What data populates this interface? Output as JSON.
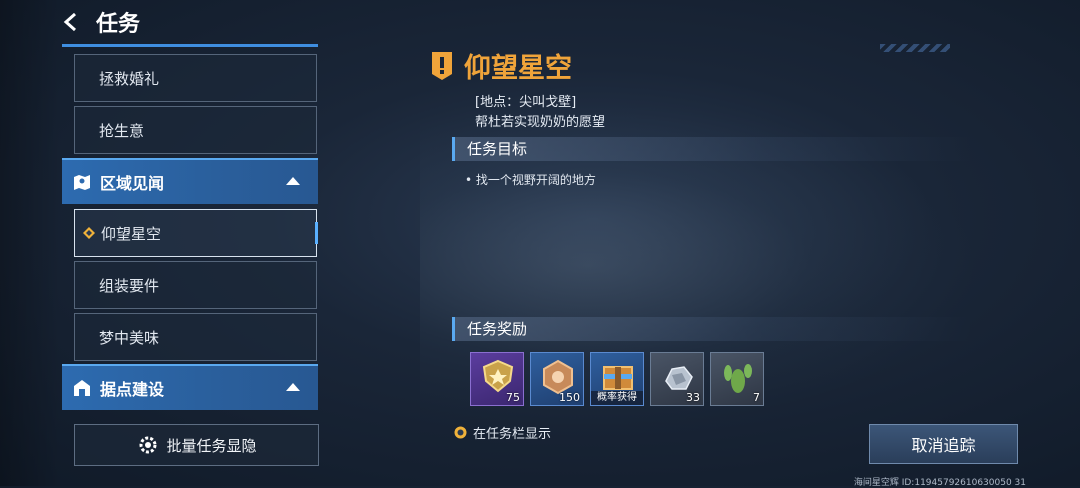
{
  "header": {
    "title": "任务"
  },
  "sidebar": {
    "items_top": [
      {
        "label": "拯救婚礼"
      },
      {
        "label": "抢生意"
      }
    ],
    "category_1": {
      "label": "区域见闻",
      "icon": "map-icon"
    },
    "items_mid": [
      {
        "label": "仰望星空",
        "selected": true
      },
      {
        "label": "组装要件"
      },
      {
        "label": "梦中美味"
      }
    ],
    "category_2": {
      "label": "据点建设",
      "icon": "base-icon"
    },
    "bulk_button": {
      "label": "批量任务显隐",
      "icon": "gear-icon"
    }
  },
  "quest": {
    "title": "仰望星空",
    "location": "[地点：尖叫戈壁]",
    "description": "帮杜若实现奶奶的愿望",
    "objective_header": "任务目标",
    "objective": "• 找一个视野开阔的地方",
    "reward_header": "任务奖励",
    "rewards": [
      {
        "icon": "rank-badge-icon",
        "count": "75",
        "rarity": "purple"
      },
      {
        "icon": "coin-icon",
        "count": "150",
        "rarity": "blue"
      },
      {
        "icon": "crate-icon",
        "tag": "概率获得",
        "rarity": "blue"
      },
      {
        "icon": "ore-icon",
        "count": "33",
        "rarity": "gray"
      },
      {
        "icon": "cactus-icon",
        "count": "7",
        "rarity": "gray"
      }
    ],
    "show_in_taskbar": "在任务栏显示",
    "cancel_button": "取消追踪"
  },
  "footer": {
    "id_text": "海间星空辉 ID:11945792610630050 31"
  },
  "colors": {
    "accent_blue": "#3f8ee0",
    "title_orange": "#f0a43a",
    "category_bg": "#2d6bb0"
  }
}
